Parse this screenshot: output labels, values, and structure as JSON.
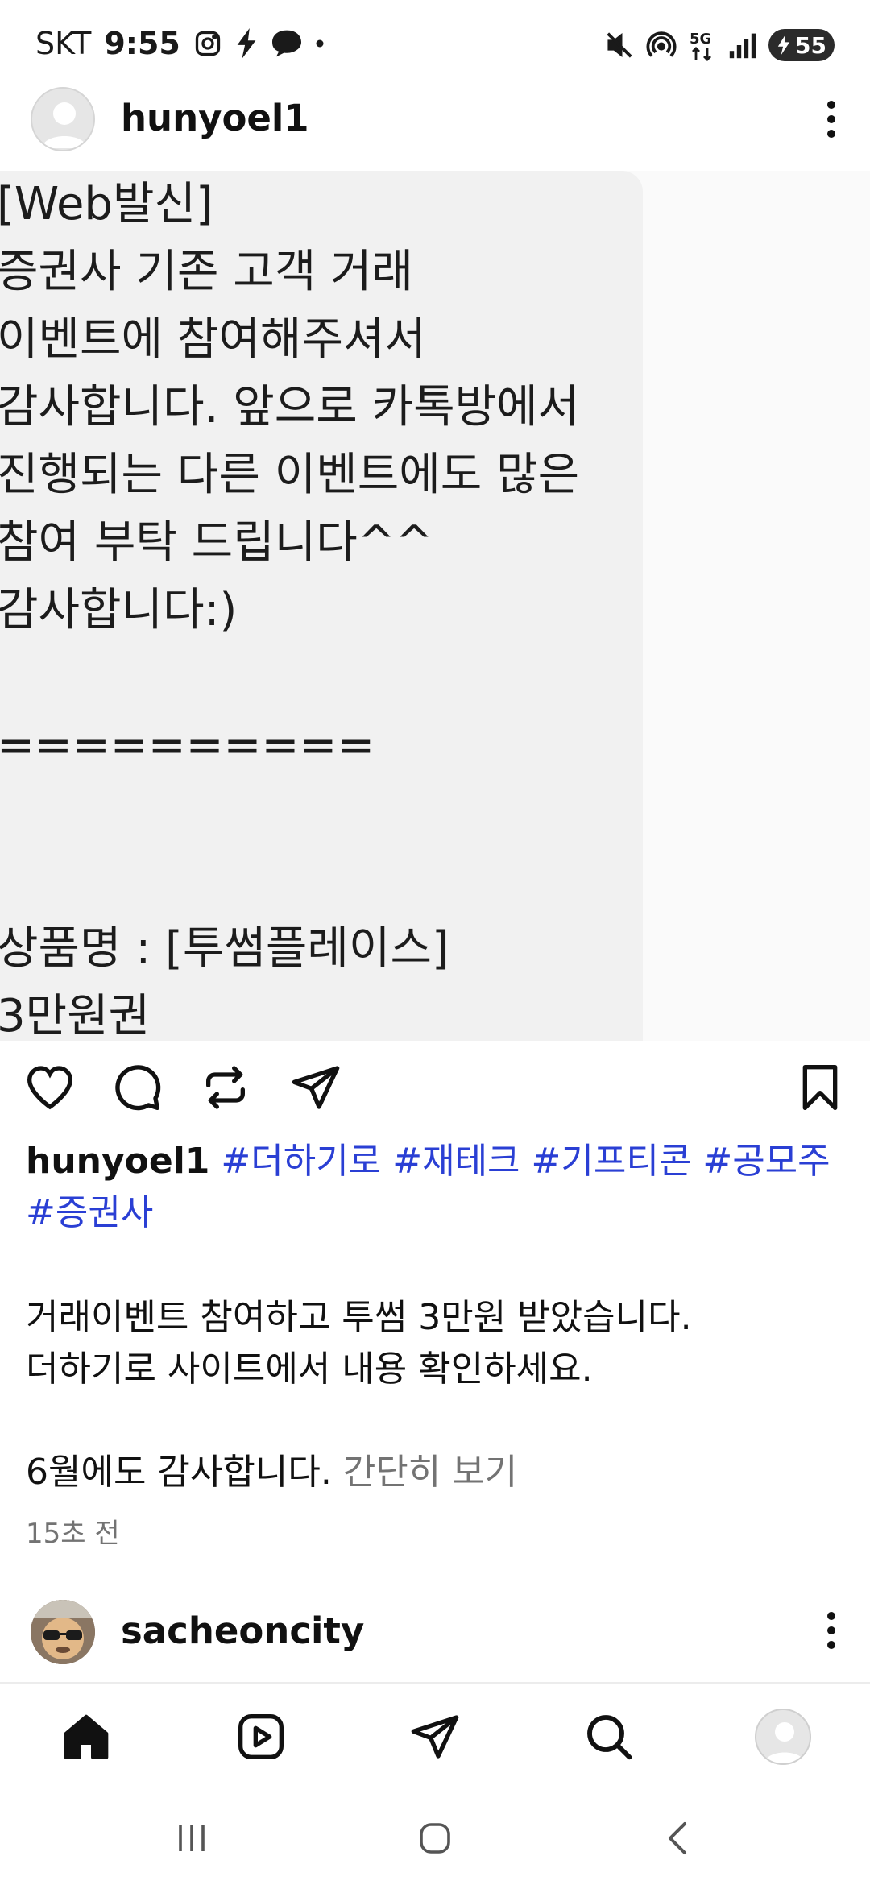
{
  "status_bar": {
    "carrier": "SKT",
    "time": "9:55",
    "battery": "55",
    "network": "5G"
  },
  "post": {
    "username": "hunyoel1",
    "image_message_lines": [
      "[Web발신]",
      "증권사 기존 고객 거래",
      "이벤트에 참여해주셔서",
      "감사합니다. 앞으로 카톡방에서",
      "진행되는 다른 이벤트에도 많은",
      "참여 부탁 드립니다^^",
      "감사합니다:)",
      "",
      "==========",
      "",
      "",
      "상품명 : [투썸플레이스]",
      "3만원권"
    ],
    "caption_username": "hunyoel1",
    "hashtags": [
      "#더하기로",
      "#재테크",
      "#기프티콘",
      "#공모주",
      "#증권사"
    ],
    "body_lines": [
      "거래이벤트 참여하고 투썸 3만원 받았습니다.",
      "더하기로 사이트에서 내용 확인하세요.",
      "",
      "6월에도 감사합니다."
    ],
    "less_link": "간단히 보기",
    "timestamp": "15초 전"
  },
  "next_post": {
    "username": "sacheoncity"
  },
  "bottom_nav": [
    "home-icon",
    "reels-icon",
    "direct-icon",
    "search-icon",
    "profile-avatar"
  ],
  "colors": {
    "hashtag": "#2a3fd4",
    "muted": "#737373",
    "bubble": "#f1f1f1"
  }
}
